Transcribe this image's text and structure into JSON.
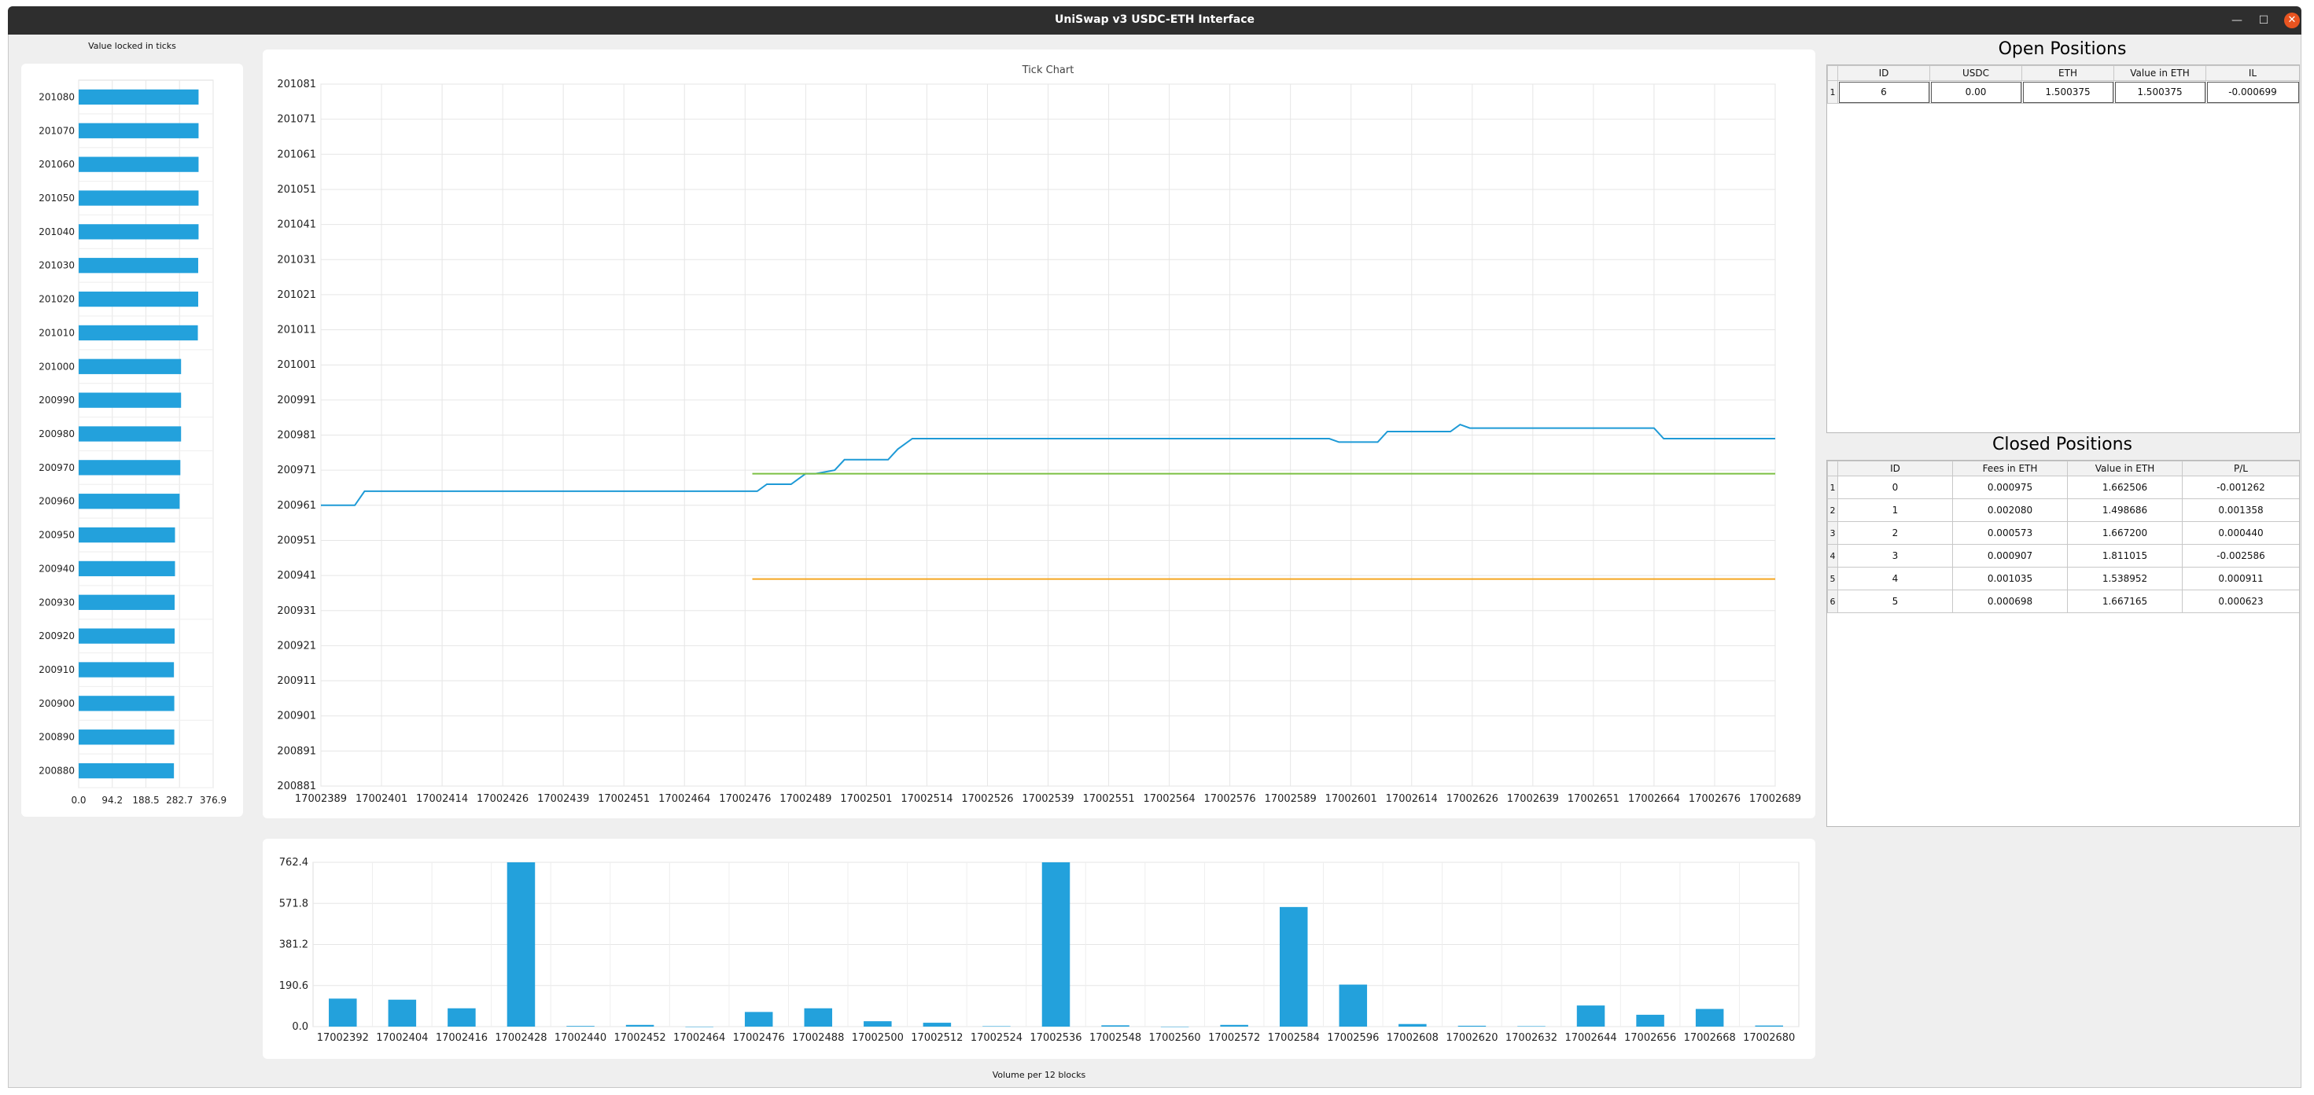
{
  "window": {
    "title": "UniSwap v3 USDC-ETH Interface",
    "controls": {
      "minimize": "—",
      "maximize": "☐",
      "close": "✕"
    }
  },
  "colors": {
    "bar": "#23a1dc",
    "price_line": "#1e9ad6",
    "upper_bound": "#7cc043",
    "lower_bound": "#f5a623",
    "titlebar": "#2e2e2e",
    "close_button": "#e95420"
  },
  "liquidity": {
    "title": "Value locked in ticks",
    "chart_data": {
      "type": "bar",
      "orientation": "horizontal",
      "categories": [
        "200880",
        "200890",
        "200900",
        "200910",
        "200920",
        "200930",
        "200940",
        "200950",
        "200960",
        "200970",
        "200980",
        "200990",
        "201000",
        "201010",
        "201020",
        "201030",
        "201040",
        "201050",
        "201060",
        "201070",
        "201080"
      ],
      "values": [
        267,
        268,
        268,
        267,
        269,
        269,
        270,
        270,
        283,
        285,
        287,
        287,
        287,
        334,
        335,
        335,
        336,
        336,
        336,
        336,
        336
      ],
      "xlim": [
        0,
        376.9
      ],
      "xticks": [
        "0.0",
        "94.2",
        "188.5",
        "282.7",
        "376.9"
      ]
    }
  },
  "tick_chart": {
    "title": "Tick Chart",
    "chart_data": {
      "type": "line",
      "yticks": [
        "200881",
        "200891",
        "200901",
        "200911",
        "200921",
        "200931",
        "200941",
        "200951",
        "200961",
        "200971",
        "200981",
        "200991",
        "201001",
        "201011",
        "201021",
        "201031",
        "201041",
        "201051",
        "201061",
        "201071",
        "201081"
      ],
      "xticks": [
        "17002389",
        "17002401",
        "17002414",
        "17002426",
        "17002439",
        "17002451",
        "17002464",
        "17002476",
        "17002489",
        "17002501",
        "17002514",
        "17002526",
        "17002539",
        "17002551",
        "17002564",
        "17002576",
        "17002589",
        "17002601",
        "17002614",
        "17002626",
        "17002639",
        "17002651",
        "17002664",
        "17002676",
        "17002689"
      ],
      "xlim": [
        17002389,
        17002689
      ],
      "ylim": [
        200881,
        201081
      ],
      "series": [
        {
          "key": "price",
          "x": [
            17002389,
            17002396,
            17002398,
            17002479,
            17002481,
            17002486,
            17002489,
            17002491,
            17002495,
            17002497,
            17002506,
            17002508,
            17002511,
            17002597,
            17002599,
            17002607,
            17002609,
            17002622,
            17002624,
            17002626,
            17002664,
            17002666,
            17002689
          ],
          "y": [
            200961,
            200961,
            200965,
            200965,
            200967,
            200967,
            200970,
            200970,
            200971,
            200974,
            200974,
            200977,
            200980,
            200980,
            200979,
            200979,
            200982,
            200982,
            200984,
            200983,
            200983,
            200980,
            200980
          ]
        },
        {
          "key": "upper_bound",
          "x": [
            17002478,
            17002689
          ],
          "y": [
            200970,
            200970
          ]
        },
        {
          "key": "lower_bound",
          "x": [
            17002478,
            17002689
          ],
          "y": [
            200940,
            200940
          ]
        }
      ]
    }
  },
  "volume": {
    "title": "Volume per 12 blocks",
    "chart_data": {
      "type": "bar",
      "categories": [
        "17002392",
        "17002404",
        "17002416",
        "17002428",
        "17002440",
        "17002452",
        "17002464",
        "17002476",
        "17002488",
        "17002500",
        "17002512",
        "17002524",
        "17002536",
        "17002548",
        "17002560",
        "17002572",
        "17002584",
        "17002596",
        "17002608",
        "17002620",
        "17002632",
        "17002644",
        "17002656",
        "17002668",
        "17002680"
      ],
      "values": [
        130,
        125,
        85,
        762.4,
        3,
        8,
        0,
        68,
        85,
        25,
        18,
        2,
        762.4,
        6,
        0,
        8,
        555,
        195,
        12,
        4,
        2,
        98,
        55,
        82,
        5
      ],
      "ylim": [
        0,
        762.4
      ],
      "yticks": [
        "0.0",
        "190.6",
        "381.2",
        "571.8",
        "762.4"
      ]
    }
  },
  "open_positions": {
    "title": "Open Positions",
    "columns": [
      "ID",
      "USDC",
      "ETH",
      "Value in ETH",
      "IL"
    ],
    "rows": [
      {
        "num": "1",
        "cells": [
          "6",
          "0.00",
          "1.500375",
          "1.500375",
          "-0.000699"
        ]
      }
    ]
  },
  "closed_positions": {
    "title": "Closed Positions",
    "columns": [
      "ID",
      "Fees in ETH",
      "Value in ETH",
      "P/L"
    ],
    "rows": [
      {
        "num": "1",
        "cells": [
          "0",
          "0.000975",
          "1.662506",
          "-0.001262"
        ]
      },
      {
        "num": "2",
        "cells": [
          "1",
          "0.002080",
          "1.498686",
          "0.001358"
        ]
      },
      {
        "num": "3",
        "cells": [
          "2",
          "0.000573",
          "1.667200",
          "0.000440"
        ]
      },
      {
        "num": "4",
        "cells": [
          "3",
          "0.000907",
          "1.811015",
          "-0.002586"
        ]
      },
      {
        "num": "5",
        "cells": [
          "4",
          "0.001035",
          "1.538952",
          "0.000911"
        ]
      },
      {
        "num": "6",
        "cells": [
          "5",
          "0.000698",
          "1.667165",
          "0.000623"
        ]
      }
    ]
  }
}
